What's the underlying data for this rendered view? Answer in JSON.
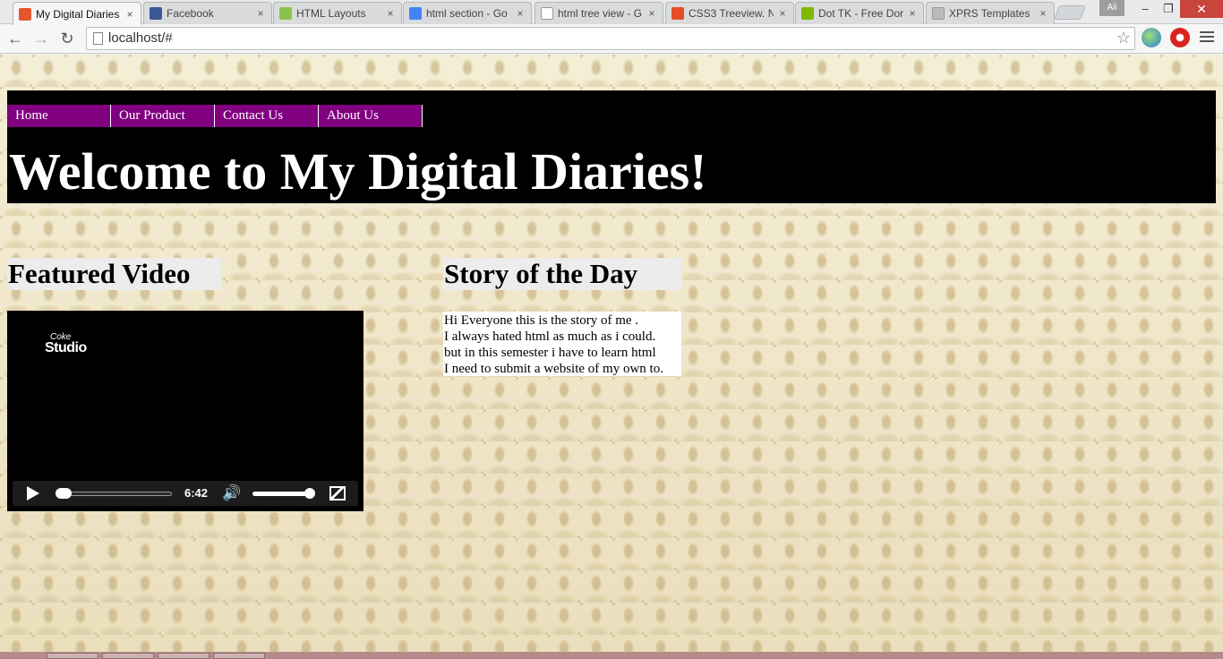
{
  "browser": {
    "tabs": [
      {
        "title": "My Digital Diaries",
        "favicon": "xampp-icon",
        "color": "#e4572e",
        "active": true
      },
      {
        "title": "Facebook",
        "favicon": "facebook-icon",
        "color": "#3b5998",
        "active": false
      },
      {
        "title": "HTML Layouts",
        "favicon": "w3schools-icon",
        "color": "#8ac249",
        "active": false
      },
      {
        "title": "html section - Go",
        "favicon": "google-icon",
        "color": "#4285f4",
        "active": false
      },
      {
        "title": "html tree view - G",
        "favicon": "page-icon",
        "color": "#ffffff",
        "active": false
      },
      {
        "title": "CSS3 Treeview. N",
        "favicon": "css3-icon",
        "color": "#e44d26",
        "active": false
      },
      {
        "title": "Dot TK - Free Dor",
        "favicon": "dottk-icon",
        "color": "#7fb900",
        "active": false
      },
      {
        "title": "XPRS Templates",
        "favicon": "loading-icon",
        "color": "#bbbbbb",
        "active": false
      }
    ],
    "tab_close_glyph": "×",
    "user": "Ali",
    "window_controls": {
      "minimize": "–",
      "restore": "❐",
      "close": "✕"
    },
    "nav": {
      "back": "←",
      "forward": "→",
      "reload": "↻"
    },
    "url": "localhost/#",
    "star": "☆"
  },
  "page": {
    "nav_items": [
      "Home",
      "Our Product",
      "Contact Us",
      "About Us"
    ],
    "colors": {
      "nav_bg": "#800080",
      "header_bg": "#000000",
      "heading_bg": "#ececec"
    },
    "site_title": "Welcome to My Digital Diaries!",
    "featured_video": {
      "heading": "Featured Video",
      "brand_line1": "Coke",
      "brand_line2": "Studio",
      "duration": "6:42",
      "progress": 0.0,
      "volume": 1.0
    },
    "story": {
      "heading": "Story of the Day",
      "lines": [
        "Hi Everyone this is the story of me .",
        "I always hated html as much as i could.",
        "but in this semester i have to learn html",
        "I need to submit a website of my own to."
      ]
    }
  }
}
